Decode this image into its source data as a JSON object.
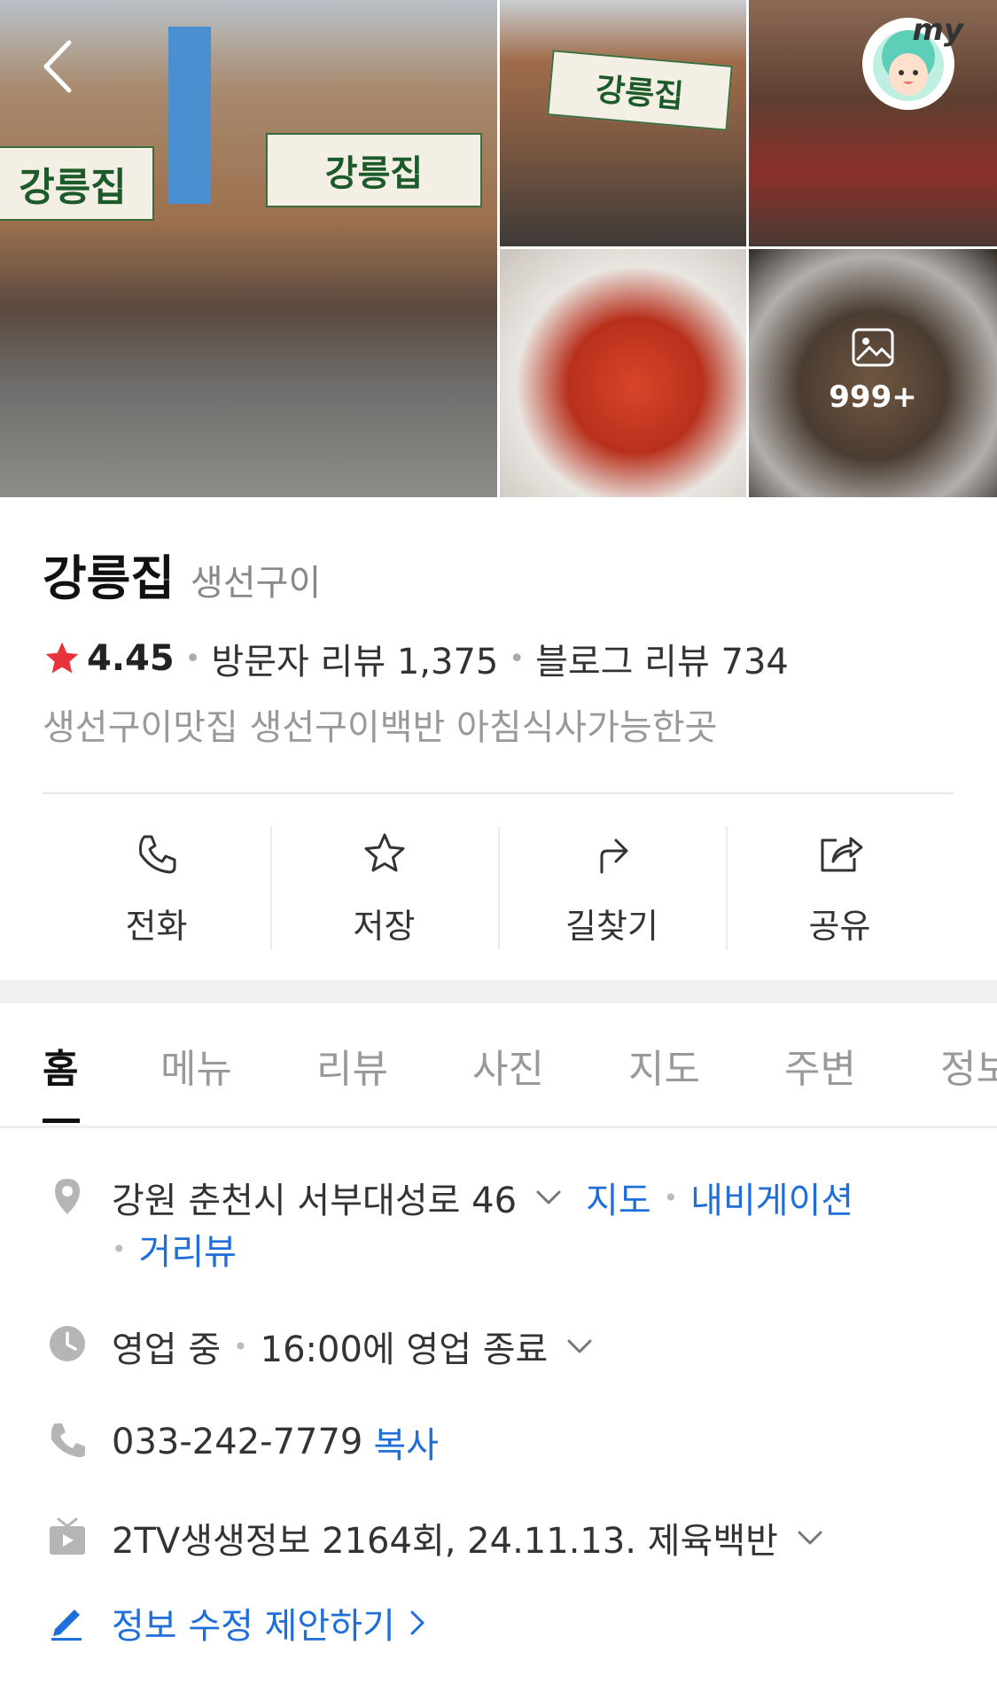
{
  "place": {
    "name": "강릉집",
    "category": "생선구이",
    "rating": "4.45",
    "visitor_review_label": "방문자 리뷰 1,375",
    "blog_review_label": "블로그 리뷰 734",
    "tagline": "생선구이맛집 생선구이백반 아침식사가능한곳"
  },
  "photos": {
    "sign_text": "강릉집",
    "more_count": "999+",
    "avatar_text": "my"
  },
  "actions": [
    {
      "label": "전화",
      "icon": "phone-icon"
    },
    {
      "label": "저장",
      "icon": "star-outline-icon"
    },
    {
      "label": "길찾기",
      "icon": "directions-icon"
    },
    {
      "label": "공유",
      "icon": "share-icon"
    }
  ],
  "tabs": [
    {
      "label": "홈",
      "active": true
    },
    {
      "label": "메뉴"
    },
    {
      "label": "리뷰"
    },
    {
      "label": "사진"
    },
    {
      "label": "지도"
    },
    {
      "label": "주변"
    },
    {
      "label": "정보"
    }
  ],
  "details": {
    "address": "강원 춘천시 서부대성로 46",
    "map_link": "지도",
    "navigation_link": "내비게이션",
    "street_view_link": "거리뷰",
    "hours_status": "영업 중",
    "hours_detail": "16:00에 영업 종료",
    "phone": "033-242-7779",
    "copy_link": "복사",
    "tv_info": "2TV생생정보 2164회, 24.11.13. 제육백반",
    "edit_suggestion": "정보 수정 제안하기"
  },
  "colors": {
    "accent_link": "#1e6fd9",
    "star": "#e8323c",
    "avatar_bg": "#bfeee3"
  }
}
